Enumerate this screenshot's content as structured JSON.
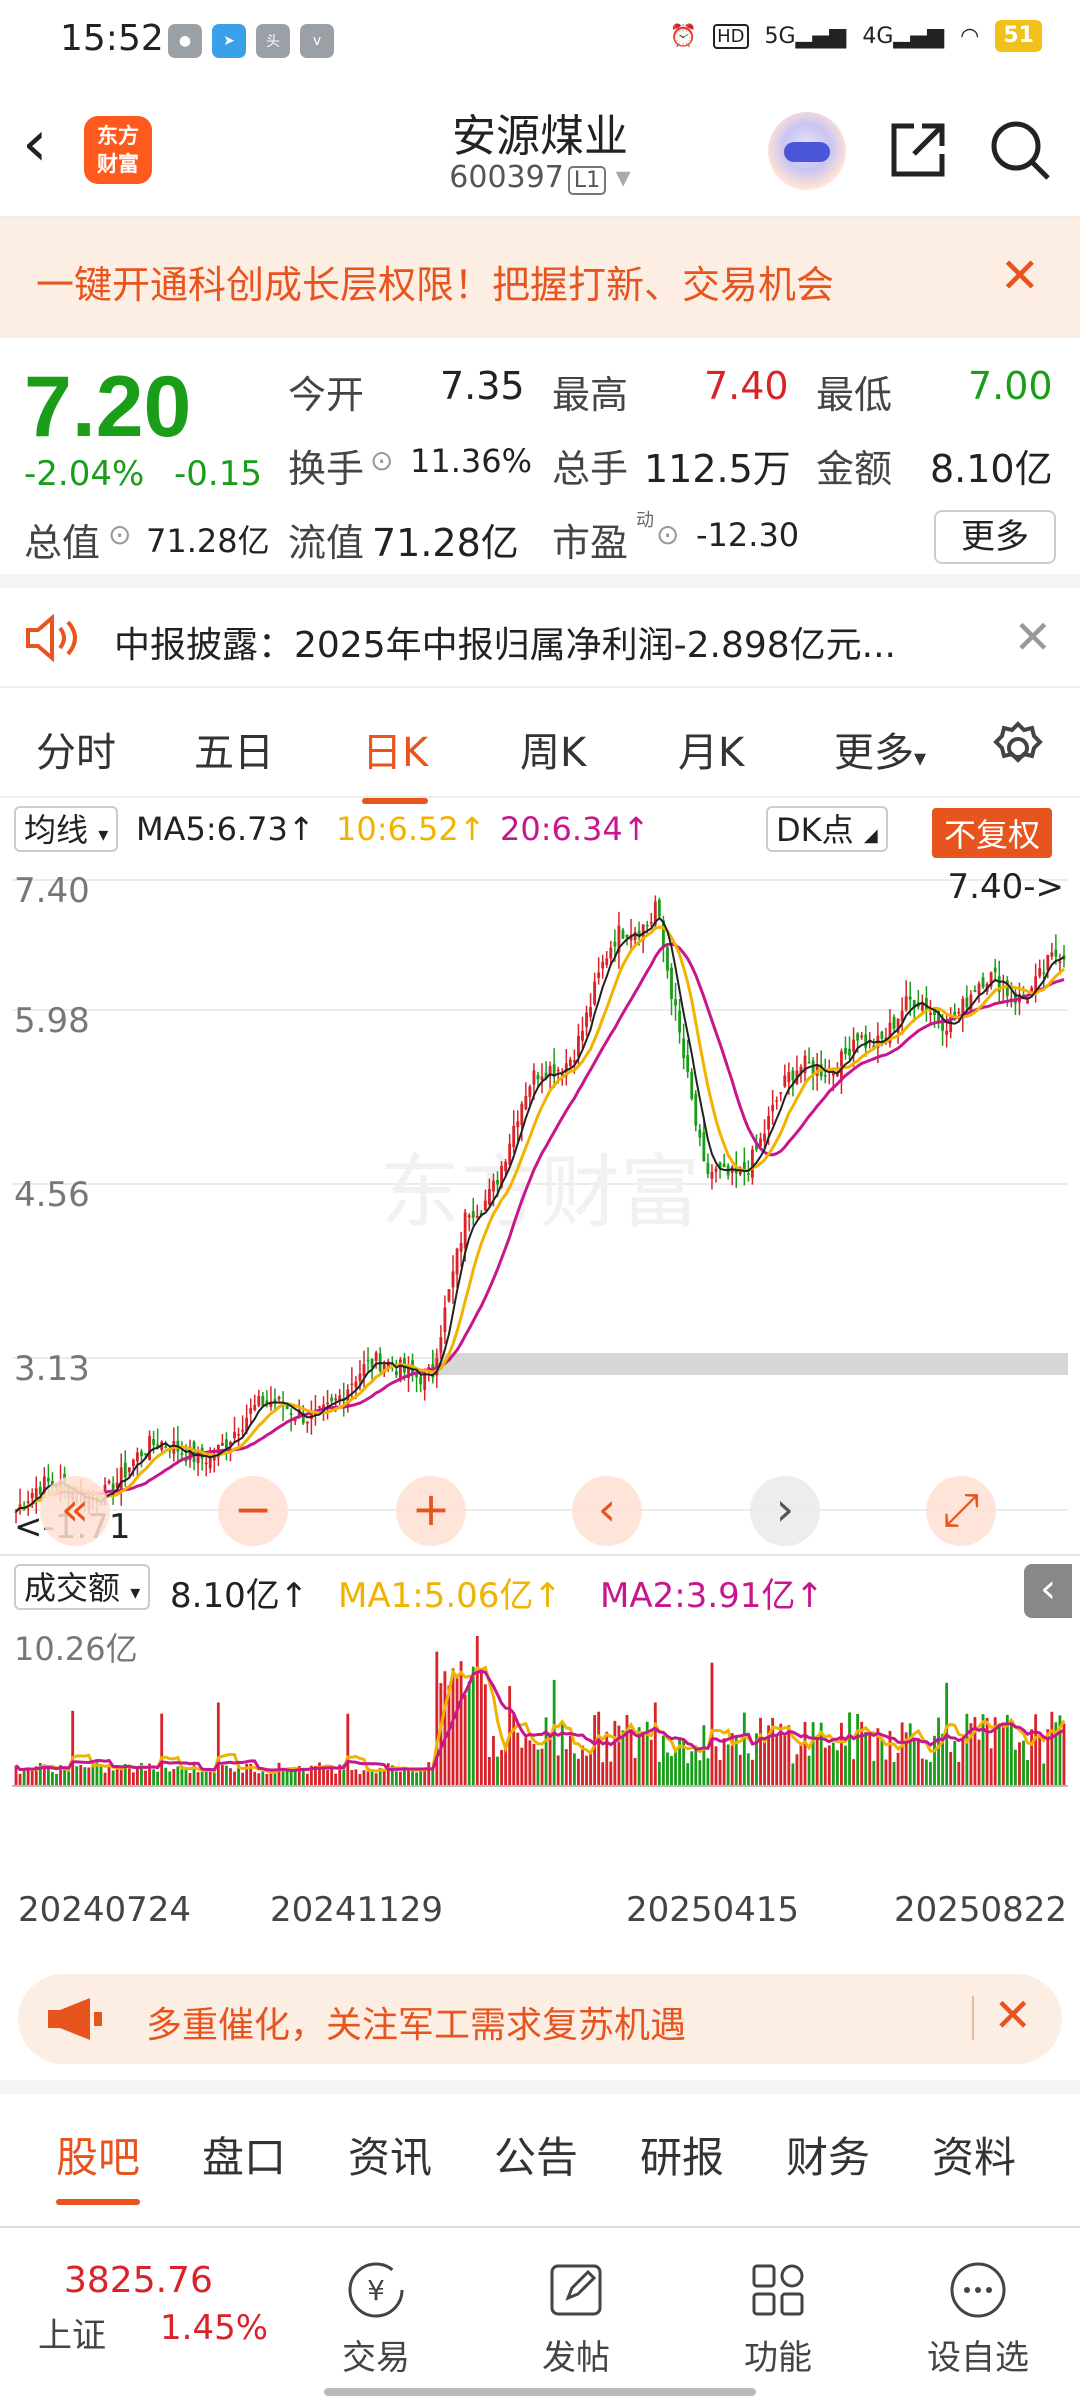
{
  "status": {
    "time": "15:52",
    "battery": "51",
    "net1": "5G",
    "net2": "4G"
  },
  "header": {
    "logo": "东方\n财富",
    "title": "安源煤业",
    "code": "600397",
    "badge": "L1"
  },
  "promo": {
    "text": "一键开通科创成长层权限！把握打新、交易机会"
  },
  "quote": {
    "price": "7.20",
    "pct": "-2.04%",
    "chg": "-0.15",
    "open_label": "今开",
    "open": "7.35",
    "high_label": "最高",
    "high": "7.40",
    "low_label": "最低",
    "low": "7.00",
    "turnover_label": "换手",
    "turnover": "11.36%",
    "vol_label": "总手",
    "vol": "112.5万",
    "amt_label": "金额",
    "amt": "8.10亿",
    "mcap_label": "总值",
    "mcap": "71.28亿",
    "float_label": "流值",
    "float": "71.28亿",
    "pe_label": "市盈",
    "pe_sup": "动",
    "pe": "-12.30",
    "more": "更多"
  },
  "notice": {
    "text": "中报披露：2025年中报归属净利润-2.898亿元..."
  },
  "tabs": [
    "分时",
    "五日",
    "日K",
    "周K",
    "月K",
    "更多"
  ],
  "kline": {
    "ma_select": "均线",
    "ma5": "MA5:6.73↑",
    "ma10": "10:6.52↑",
    "ma20": "20:6.34↑",
    "dk": "DK点",
    "fq": "不复权",
    "y_labels": [
      "7.40",
      "5.98",
      "4.56",
      "3.13"
    ],
    "max_label": "7.40->",
    "min_label": "<-1.71",
    "colors": {
      "ma5": "#222222",
      "ma10": "#f0b400",
      "ma20": "#c8168c",
      "up": "#d8232a",
      "down": "#1a9e1a"
    }
  },
  "volume": {
    "select": "成交额",
    "value": "8.10亿↑",
    "ma1": "MA1:5.06亿↑",
    "ma2": "MA2:3.91亿↑",
    "ylabel": "10.26亿",
    "dates": [
      "20240724",
      "20241129",
      "20250415",
      "20250822"
    ]
  },
  "ad": {
    "text": "多重催化，关注军工需求复苏机遇"
  },
  "subtabs": [
    "股吧",
    "盘口",
    "资讯",
    "公告",
    "研报",
    "财务",
    "资料"
  ],
  "bottom": {
    "index_value": "3825.76",
    "index_name": "上证",
    "index_pct": "1.45%",
    "items": [
      "交易",
      "发帖",
      "功能",
      "设自选"
    ]
  }
}
